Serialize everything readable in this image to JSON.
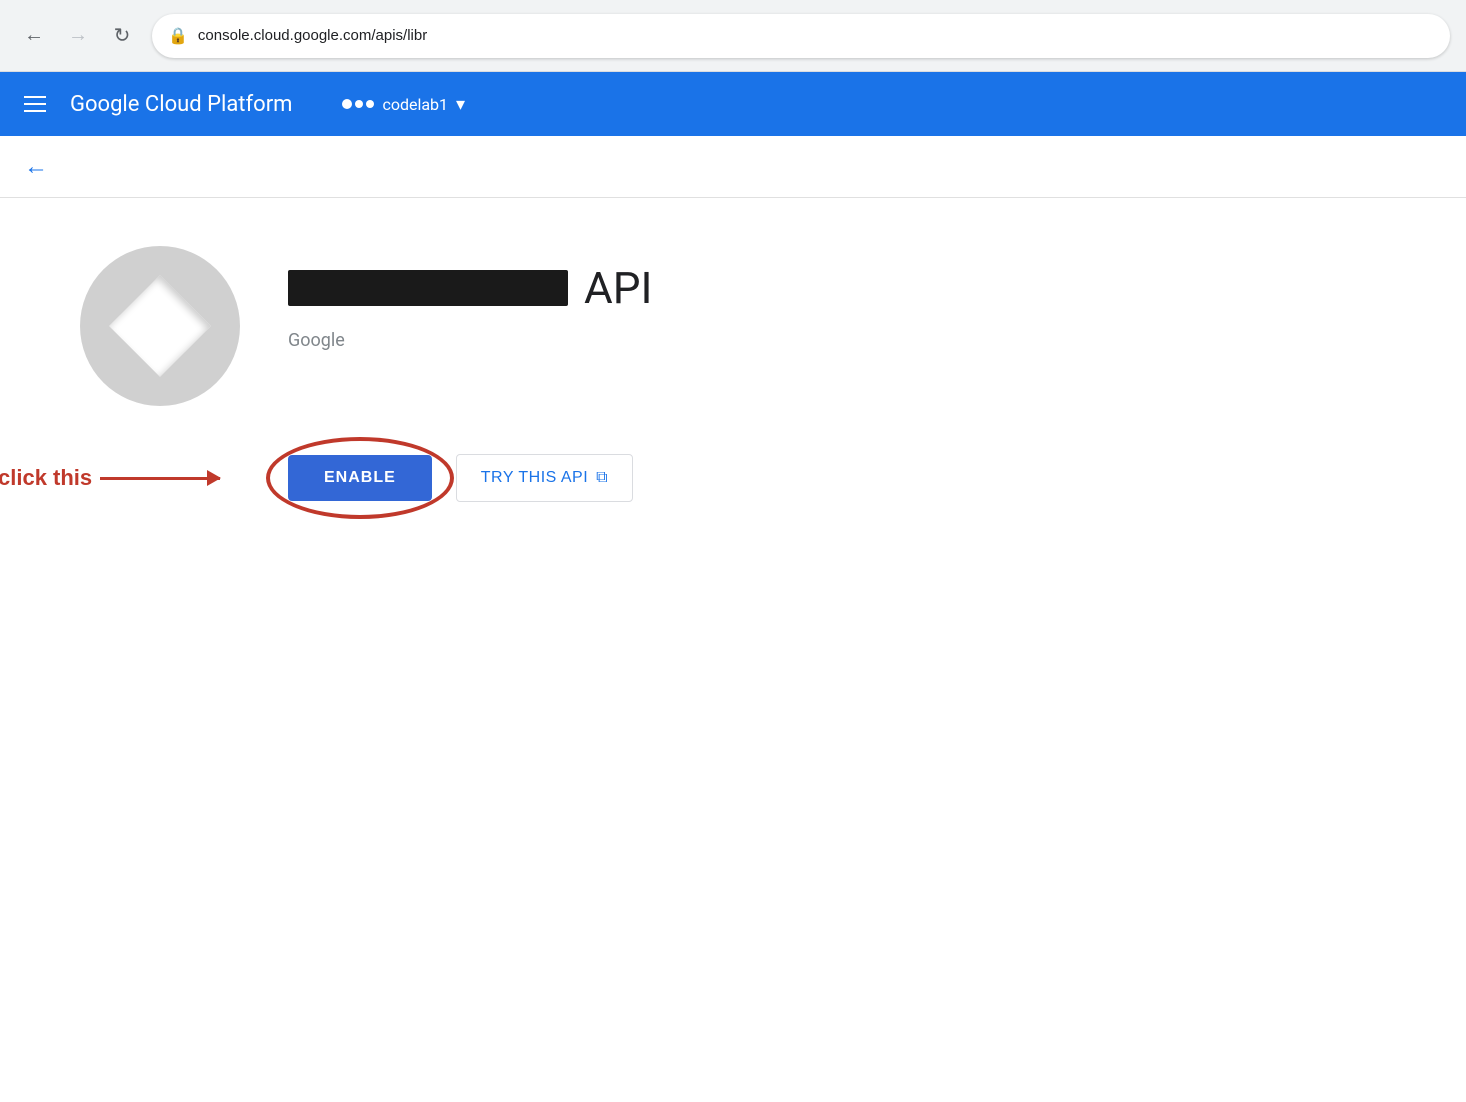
{
  "browser": {
    "back_label": "←",
    "forward_label": "→",
    "reload_label": "↻",
    "lock_icon": "🔒",
    "address": "console.cloud.google.com/apis/libr"
  },
  "header": {
    "menu_label": "Menu",
    "title": "Google Cloud Platform",
    "project_name": "codelab1",
    "dropdown_label": "▾"
  },
  "page": {
    "back_label": "←",
    "api": {
      "name_suffix": "API",
      "provider": "Google",
      "icon_label": "API Icon"
    },
    "buttons": {
      "enable_label": "ENABLE",
      "try_api_label": "TRY THIS API",
      "external_icon": "⧉"
    },
    "annotation": {
      "click_text": "click this"
    }
  }
}
